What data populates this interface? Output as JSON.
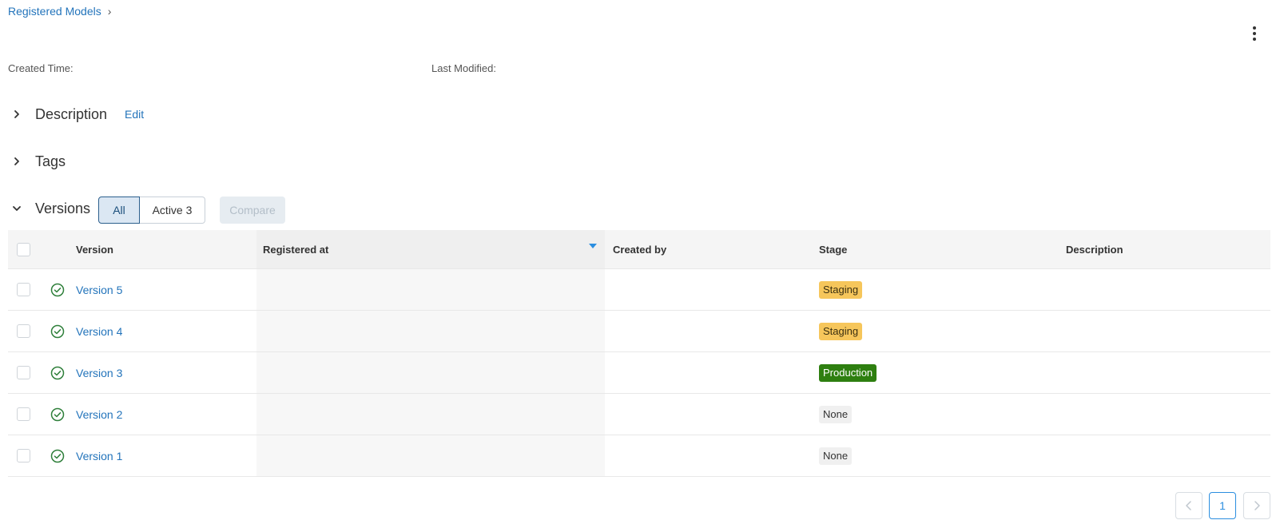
{
  "breadcrumb": {
    "label": "Registered Models",
    "separator": "›"
  },
  "meta": {
    "created_label": "Created Time:",
    "modified_label": "Last Modified:"
  },
  "sections": {
    "description": {
      "title": "Description",
      "edit_label": "Edit"
    },
    "tags": {
      "title": "Tags"
    },
    "versions": {
      "title": "Versions"
    }
  },
  "filters": {
    "all_label": "All",
    "active_label": "Active 3",
    "compare_label": "Compare"
  },
  "table": {
    "headers": {
      "version": "Version",
      "registered_at": "Registered at",
      "created_by": "Created by",
      "stage": "Stage",
      "description": "Description"
    },
    "rows": [
      {
        "version": "Version 5",
        "registered_at": "",
        "created_by": "",
        "stage": "Staging",
        "description": ""
      },
      {
        "version": "Version 4",
        "registered_at": "",
        "created_by": "",
        "stage": "Staging",
        "description": ""
      },
      {
        "version": "Version 3",
        "registered_at": "",
        "created_by": "",
        "stage": "Production",
        "description": ""
      },
      {
        "version": "Version 2",
        "registered_at": "",
        "created_by": "",
        "stage": "None",
        "description": ""
      },
      {
        "version": "Version 1",
        "registered_at": "",
        "created_by": "",
        "stage": "None",
        "description": ""
      }
    ]
  },
  "pagination": {
    "prev": "<",
    "current": "1",
    "next": ">"
  },
  "colors": {
    "link": "#2374bb",
    "staging": "#f6c65b",
    "production": "#2e7f10",
    "none": "#f0f0f0",
    "status_ready": "#2e7f3a",
    "sort_accent": "#2b8ee0"
  },
  "icons": {
    "status": "check-circle-icon",
    "more": "kebab-menu-icon",
    "expand": "chevron-icon"
  }
}
